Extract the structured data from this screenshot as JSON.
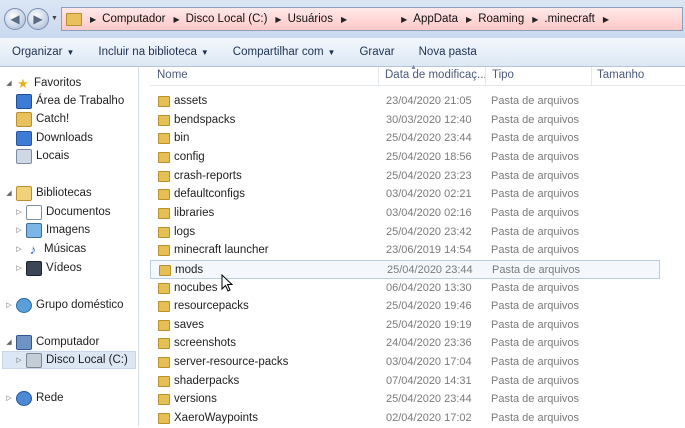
{
  "address": {
    "segments": [
      "Computador",
      "Disco Local (C:)",
      "Usuários",
      "",
      "AppData",
      "Roaming",
      ".minecraft"
    ]
  },
  "toolbar": {
    "organize": "Organizar",
    "include": "Incluir na biblioteca",
    "share": "Compartilhar com",
    "burn": "Gravar",
    "new_folder": "Nova pasta"
  },
  "nav": {
    "favorites": "Favoritos",
    "desktop": "Área de Trabalho",
    "catch": "Catch!",
    "downloads": "Downloads",
    "places": "Locais",
    "libraries": "Bibliotecas",
    "documents": "Documentos",
    "images": "Imagens",
    "music": "Músicas",
    "videos": "Vídeos",
    "homegroup": "Grupo doméstico",
    "computer": "Computador",
    "local_disk": "Disco Local (C:)",
    "network": "Rede"
  },
  "columns": {
    "name": "Nome",
    "date": "Data de modificaç...",
    "type": "Tipo",
    "size": "Tamanho"
  },
  "files": [
    {
      "name": "assets",
      "date": "23/04/2020 21:05",
      "type": "Pasta de arquivos"
    },
    {
      "name": "bendspacks",
      "date": "30/03/2020 12:40",
      "type": "Pasta de arquivos"
    },
    {
      "name": "bin",
      "date": "25/04/2020 23:44",
      "type": "Pasta de arquivos"
    },
    {
      "name": "config",
      "date": "25/04/2020 18:56",
      "type": "Pasta de arquivos"
    },
    {
      "name": "crash-reports",
      "date": "25/04/2020 23:23",
      "type": "Pasta de arquivos"
    },
    {
      "name": "defaultconfigs",
      "date": "03/04/2020 02:21",
      "type": "Pasta de arquivos"
    },
    {
      "name": "libraries",
      "date": "03/04/2020 02:16",
      "type": "Pasta de arquivos"
    },
    {
      "name": "logs",
      "date": "25/04/2020 23:42",
      "type": "Pasta de arquivos"
    },
    {
      "name": "minecraft launcher",
      "date": "23/06/2019 14:54",
      "type": "Pasta de arquivos"
    },
    {
      "name": "mods",
      "date": "25/04/2020 23:44",
      "type": "Pasta de arquivos"
    },
    {
      "name": "nocubes",
      "date": "06/04/2020 13:30",
      "type": "Pasta de arquivos"
    },
    {
      "name": "resourcepacks",
      "date": "25/04/2020 19:46",
      "type": "Pasta de arquivos"
    },
    {
      "name": "saves",
      "date": "25/04/2020 19:19",
      "type": "Pasta de arquivos"
    },
    {
      "name": "screenshots",
      "date": "24/04/2020 23:36",
      "type": "Pasta de arquivos"
    },
    {
      "name": "server-resource-packs",
      "date": "03/04/2020 17:04",
      "type": "Pasta de arquivos"
    },
    {
      "name": "shaderpacks",
      "date": "07/04/2020 14:31",
      "type": "Pasta de arquivos"
    },
    {
      "name": "versions",
      "date": "25/04/2020 23:44",
      "type": "Pasta de arquivos"
    },
    {
      "name": "XaeroWaypoints",
      "date": "02/04/2020 17:02",
      "type": "Pasta de arquivos"
    }
  ],
  "colors": {
    "address_bg": "#ffc8c8",
    "folder": "#e6bf55",
    "selection": "#dde7f3"
  }
}
